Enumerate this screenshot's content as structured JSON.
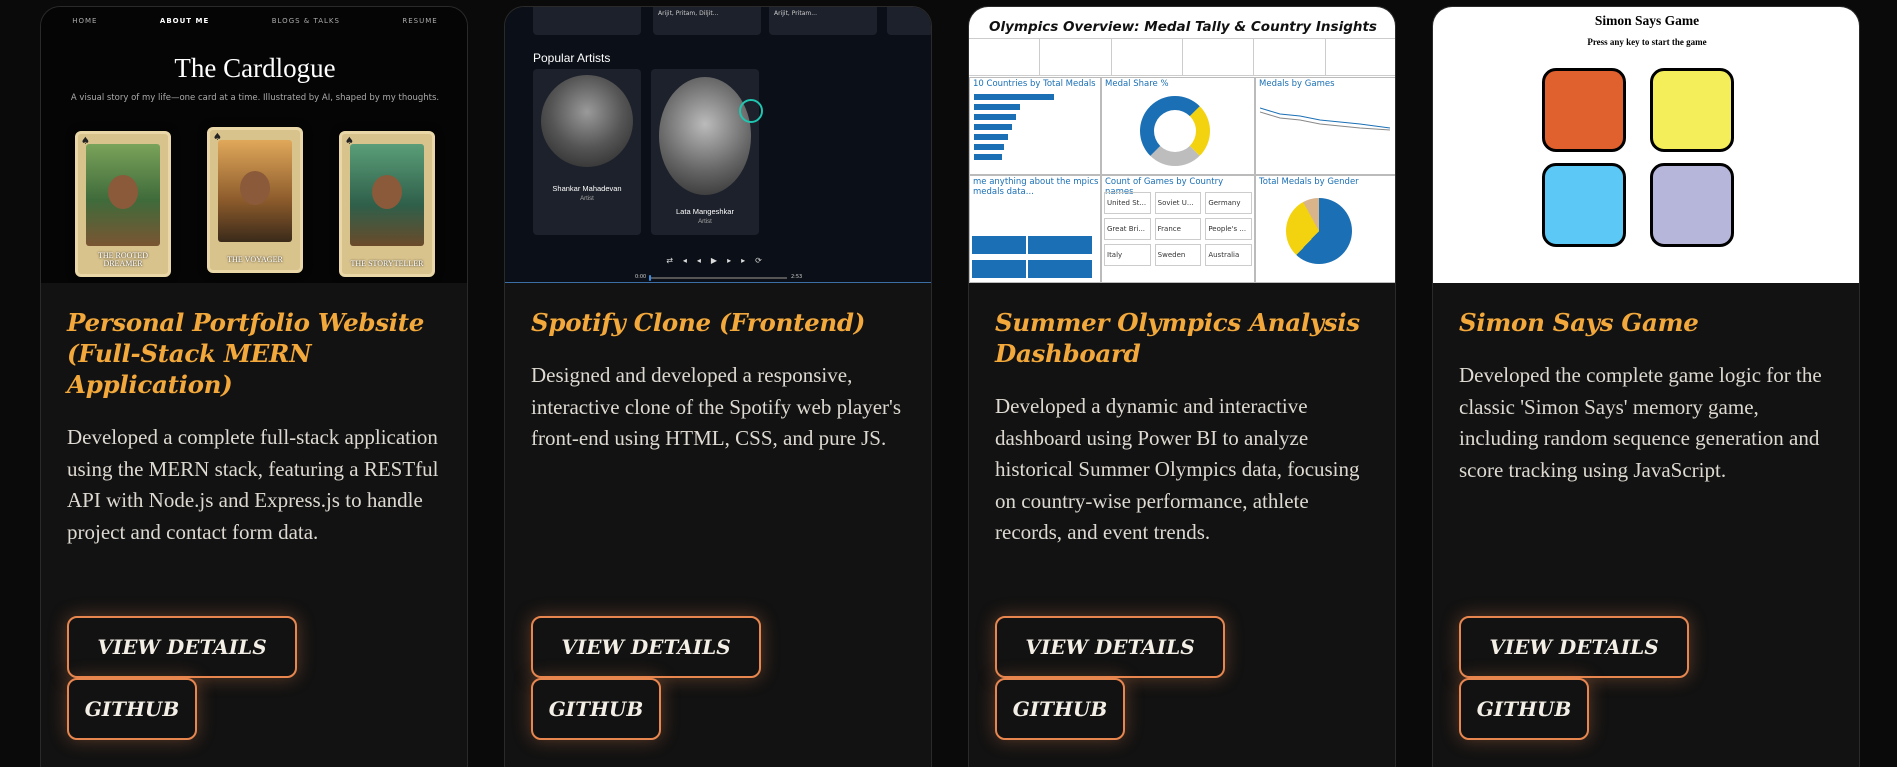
{
  "cards": [
    {
      "title": "Personal Portfolio Website (Full-Stack MERN Application)",
      "description": "Developed a complete full-stack application using the MERN stack, featuring a RESTful API with Node.js and Express.js to handle project and contact form data.",
      "details_label": "VIEW DETAILS",
      "github_label": "GITHUB",
      "preview": {
        "nav": [
          "HOME",
          "ABOUT ME",
          "BLOGS & TALKS",
          "RESUME"
        ],
        "heading": "The Cardlogue",
        "subtitle": "A visual story of my life—one card at a time. Illustrated by AI, shaped by my thoughts.",
        "tarot": [
          "THE ROOTED DREAMER",
          "THE VOYAGER",
          "THE STORYTELLER"
        ]
      }
    },
    {
      "title": "Spotify Clone (Frontend)",
      "description": "Designed and developed a responsive, interactive clone of the Spotify web player's front-end using HTML, CSS, and pure JS.",
      "details_label": "VIEW DETAILS",
      "github_label": "GITHUB",
      "preview": {
        "top_snippets": [
          "Arijit, Pritam, Diljit...",
          "Arijit, Pritam..."
        ],
        "section_heading": "Popular Artists",
        "artists": [
          {
            "name": "Shankar Mahadevan",
            "role": "Artist"
          },
          {
            "name": "Lata Mangeshkar",
            "role": "Artist"
          }
        ],
        "time_start": "0:00",
        "time_end": "2:53"
      }
    },
    {
      "title": "Summer Olympics Analysis Dashboard",
      "description": "Developed a dynamic and interactive dashboard using Power BI to analyze historical Summer Olympics data, focusing on country-wise performance, athlete records, and event trends.",
      "details_label": "VIEW DETAILS",
      "github_label": "GITHUB",
      "preview": {
        "heading": "Olympics Overview: Medal Tally & Country Insights",
        "panels": [
          "10 Countries by Total Medals",
          "Medal Share %",
          "Medals by Games",
          "me anything about the mpics medals data...",
          "Count of Games by Country names",
          "Total Medals by Gender"
        ],
        "countries": [
          "United St...",
          "Soviet U...",
          "Germany",
          "Great Bri...",
          "France",
          "People's ...",
          "Italy",
          "Sweden",
          "Australia"
        ]
      }
    },
    {
      "title": "Simon Says Game",
      "description": "Developed the complete game logic for the classic 'Simon Says' memory game, including random sequence generation and score tracking using JavaScript.",
      "details_label": "VIEW DETAILS",
      "github_label": "GITHUB",
      "preview": {
        "heading": "Simon Says Game",
        "subtitle": "Press any key to start the game",
        "colors": [
          "#e0602e",
          "#f3ee5a",
          "#5bc8f5",
          "#b6b6db"
        ]
      }
    }
  ],
  "colors": {
    "accent_title": "#f2a83b",
    "button_border": "#e8864f",
    "background": "#0a0a0a"
  }
}
